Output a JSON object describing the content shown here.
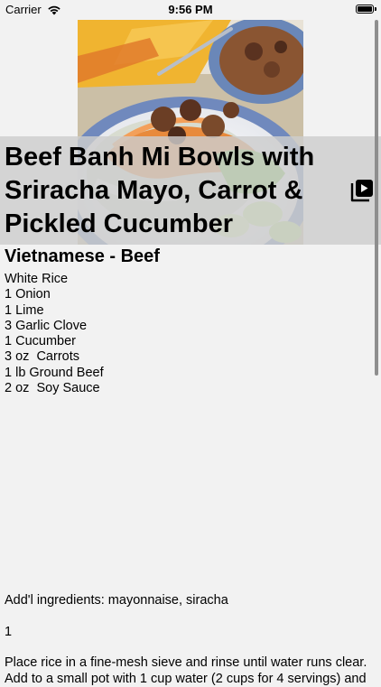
{
  "status_bar": {
    "carrier": "Carrier",
    "time": "9:56 PM",
    "icons": [
      "wifi-icon",
      "battery-icon"
    ]
  },
  "recipe": {
    "title": "Beef Banh Mi Bowls with Sriracha Mayo, Carrot & Pickled Cucumber",
    "category": "Vietnamese - Beef",
    "ingredients": [
      "White Rice",
      "1 Onion",
      "1 Lime",
      "3 Garlic Clove",
      "1 Cucumber",
      "3 oz  Carrots",
      "1 lb Ground Beef",
      "2 oz  Soy Sauce"
    ],
    "additional_ingredients": "Add'l ingredients: mayonnaise, siracha",
    "step_number": "1",
    "instructions_line1": "Place rice in a fine-mesh sieve and rinse until water runs clear.",
    "instructions_line2": "Add to a small pot with 1 cup water (2 cups for 4 servings) and"
  },
  "icons": {
    "video": "video-library-icon",
    "photo": "recipe-photo"
  }
}
